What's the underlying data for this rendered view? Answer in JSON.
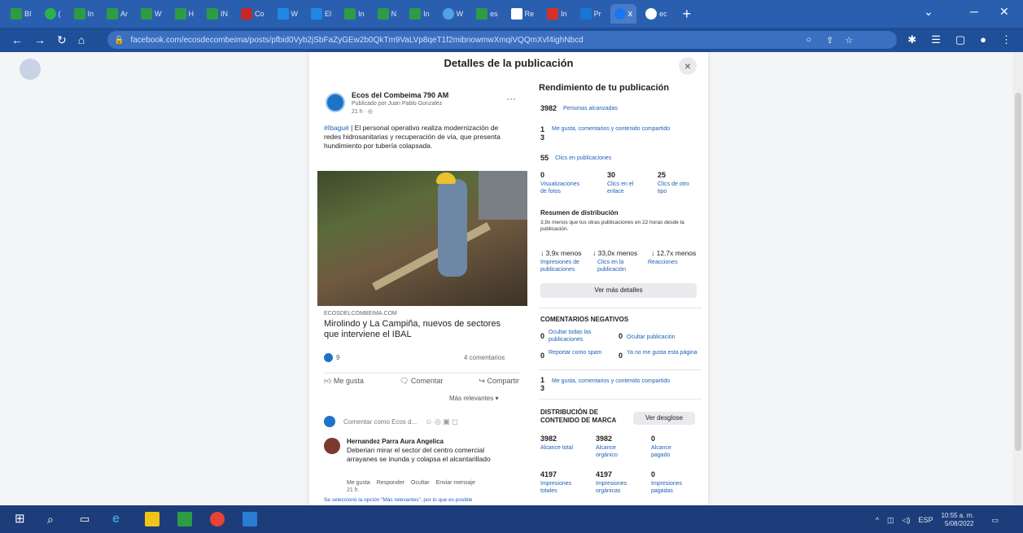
{
  "browser": {
    "url": "facebook.com/ecosdecombeima/posts/pfbid0Vyb2jSbFaZyGEw2b0QkTm9VaLVp8qeT1f2mibnowmwXmqiVQQmXvf4ighNbcd",
    "tab_labels": [
      "BI",
      "(",
      "In",
      "Ar",
      "W",
      "H",
      "IN",
      "Co",
      "W",
      "El",
      "In",
      "N",
      "In",
      "W",
      "es",
      "Re",
      "In",
      "Pr",
      "ec"
    ],
    "active_tab_label": "x",
    "new_tab": "+"
  },
  "modal": {
    "title": "Detalles de la publicación",
    "close": "×"
  },
  "post": {
    "page_name": "Ecos del Combeima 790 AM",
    "published_by": "Publicado por Juan Pablo Gonzalez",
    "time": "21 h · ◎",
    "more": "···",
    "hashtag": "#Ibagué",
    "text": " | El personal operativo realiza modernización de redes hidrosanitarias y recuperación de vía, que presenta hundimiento por tubería colapsada.",
    "link_source": "ECOSDELCOMBEIMA.COM",
    "link_title": "Mirolindo y La Campiña, nuevos de sectores que interviene el IBAL",
    "reaction_count": "9",
    "comments_count": "4 comentarios",
    "actions": {
      "like": "Me gusta",
      "comment": "Comentar",
      "share": "Compartir"
    },
    "relevance": "Más relevantes ▾",
    "comment_placeholder": "Comentar como Ecos d...",
    "comment": {
      "author": "Hernandez Parra Aura Angelica",
      "text": "Deberian mirar el sector del centro comercial arrayanes se inunda y colapsa el alcantarillado",
      "actions": [
        "Me gusta",
        "Responder",
        "Ocultar",
        "Enviar mensaje"
      ],
      "time": "21 h"
    },
    "footnote": "Se seleccionó la opción \"Más relevantes\", por lo que es posible"
  },
  "insights": {
    "title": "Rendimiento de tu publicación",
    "reach_value": "3982",
    "reach_label": "Personas alcanzadas",
    "interactions_value": "1 3",
    "interactions_label": "Me gusta, comentarios y contenido compartido",
    "clicks_value": "55",
    "clicks_label": "Clics en publicaciones",
    "breakdown": [
      {
        "value": "0",
        "label": "Visualizaciones de fotos"
      },
      {
        "value": "30",
        "label": "Clics en el enlace"
      },
      {
        "value": "25",
        "label": "Clics de otro tipo"
      }
    ],
    "distribution_title": "Resumen de distribución",
    "distribution_note": "3,9x menos que tus otras publicaciones en 22 horas desde la publicación.",
    "comparisons": [
      {
        "value": "↓ 3,9x menos",
        "label": "Impresiones de publicaciones"
      },
      {
        "value": "↓ 33,0x menos",
        "label": "Clics en la publicación"
      },
      {
        "value": "↓ 12,7x menos",
        "label": "Reacciones"
      }
    ],
    "more_details": "Ver más detalles",
    "negative_title": "COMENTARIOS NEGATIVOS",
    "negative": [
      {
        "value": "0",
        "label": "Ocultar todas las publicaciones"
      },
      {
        "value": "0",
        "label": "Ocultar publicación"
      },
      {
        "value": "0",
        "label": "Reportar como spam"
      },
      {
        "value": "0",
        "label": "Ya no me gusta esta página"
      }
    ],
    "interactions2_value": "1 3",
    "interactions2_label": "Me gusta, comentarios y contenido compartido",
    "brand_title": "DISTRIBUCIÓN DE CONTENIDO DE MARCA",
    "brand_button": "Ver desglose",
    "brand_reach": [
      {
        "value": "3982",
        "label": "Alcance total"
      },
      {
        "value": "3982",
        "label": "Alcance orgánico"
      },
      {
        "value": "0",
        "label": "Alcance pagado"
      }
    ],
    "brand_impressions": [
      {
        "value": "4197",
        "label": "Impresiones totales"
      },
      {
        "value": "4197",
        "label": "Impresiones orgánicas"
      },
      {
        "value": "0",
        "label": "Impresiones pagadas"
      }
    ]
  },
  "taskbar": {
    "language": "ESP",
    "time": "10:55 a. m.",
    "date": "5/08/2022"
  },
  "colors": {
    "chrome_blue": "#2a5fb0",
    "fb_blue": "#1d5fb8",
    "taskbar": "#1d3d7a"
  }
}
